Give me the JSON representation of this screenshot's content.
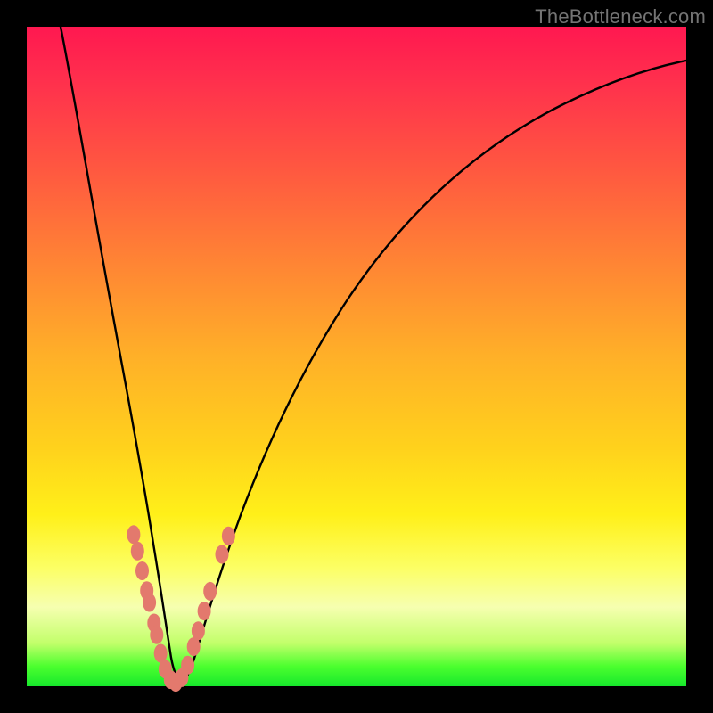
{
  "watermark": "TheBottleneck.com",
  "colors": {
    "marker": "#e3796d",
    "curve": "#000000",
    "gradient_top": "#ff1850",
    "gradient_bottom": "#17e82c"
  },
  "chart_data": {
    "type": "line",
    "title": "",
    "xlabel": "",
    "ylabel": "",
    "xlim": [
      0,
      100
    ],
    "ylim": [
      0,
      100
    ],
    "grid": false,
    "legend": false,
    "description": "V-shaped bottleneck curve; score (y) vs. component balance ratio (x). Minimum near x≈22 where bottleneck ≈ 0.",
    "series": [
      {
        "name": "bottleneck-curve",
        "x": [
          0,
          2,
          4,
          6,
          8,
          10,
          12,
          14,
          16,
          18,
          19,
          20,
          21,
          22,
          23,
          24,
          25,
          27,
          30,
          34,
          38,
          44,
          50,
          58,
          66,
          74,
          82,
          90,
          100
        ],
        "y": [
          100,
          88,
          76,
          65,
          55,
          46,
          38,
          30,
          22,
          14,
          10,
          6,
          3,
          1,
          0.5,
          1,
          3,
          8,
          16,
          26,
          35,
          46,
          55,
          64,
          71,
          77,
          81,
          85,
          89
        ]
      }
    ],
    "markers": {
      "description": "salmon dashed markers along lower part of both arms of the V",
      "points": [
        {
          "x": 16.2,
          "y": 23.0
        },
        {
          "x": 16.8,
          "y": 20.5
        },
        {
          "x": 17.5,
          "y": 17.5
        },
        {
          "x": 18.2,
          "y": 14.5
        },
        {
          "x": 18.6,
          "y": 12.7
        },
        {
          "x": 19.3,
          "y": 9.6
        },
        {
          "x": 19.7,
          "y": 7.8
        },
        {
          "x": 20.3,
          "y": 5.0
        },
        {
          "x": 21.0,
          "y": 2.6
        },
        {
          "x": 21.8,
          "y": 1.0
        },
        {
          "x": 22.6,
          "y": 0.6
        },
        {
          "x": 23.5,
          "y": 1.3
        },
        {
          "x": 24.4,
          "y": 3.2
        },
        {
          "x": 25.3,
          "y": 6.0
        },
        {
          "x": 26.0,
          "y": 8.4
        },
        {
          "x": 26.9,
          "y": 11.4
        },
        {
          "x": 27.8,
          "y": 14.4
        },
        {
          "x": 29.6,
          "y": 20.0
        },
        {
          "x": 30.6,
          "y": 22.8
        }
      ]
    }
  }
}
